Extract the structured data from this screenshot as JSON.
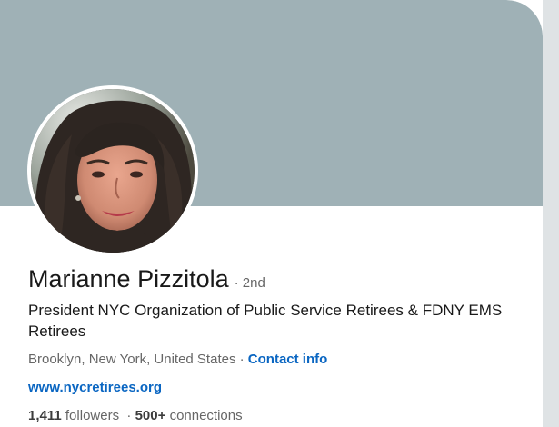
{
  "profile": {
    "name": "Marianne Pizzitola",
    "degree": "2nd",
    "headline": "President NYC Organization of Public Service Retirees & FDNY EMS Retirees",
    "location": "Brooklyn, New York, United States",
    "separator": "·",
    "contact_label": "Contact info",
    "website": "www.nycretirees.org",
    "followers_count": "1,411",
    "followers_label": "followers",
    "connections_count": "500+",
    "connections_label": "connections"
  },
  "colors": {
    "banner": "#9fb1b6",
    "link": "#0a66c2",
    "name_text": "#191919",
    "muted_text": "#666666"
  }
}
